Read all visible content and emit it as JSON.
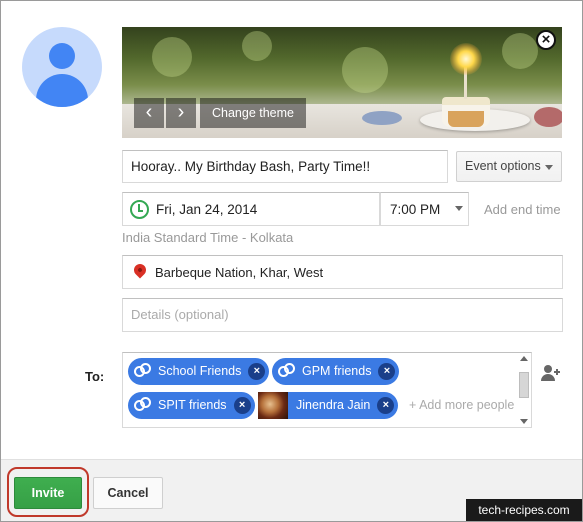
{
  "theme": {
    "prev_glyph": "‹",
    "next_glyph": "›",
    "change_theme_label": "Change theme",
    "close_glyph": "×"
  },
  "event": {
    "title": "Hooray.. My Birthday Bash, Party Time!!",
    "options_label": "Event options",
    "date": "Fri, Jan 24, 2014",
    "time": "7:00 PM",
    "add_end_time_label": "Add end time",
    "timezone": "India Standard Time - Kolkata",
    "location": "Barbeque Nation, Khar, West",
    "details_placeholder": "Details (optional)"
  },
  "guests": {
    "to_label": "To:",
    "chips": [
      {
        "label": "School Friends",
        "kind": "group"
      },
      {
        "label": "GPM friends",
        "kind": "group"
      },
      {
        "label": "SPIT friends",
        "kind": "group"
      },
      {
        "label": "Jinendra Jain",
        "kind": "person"
      }
    ],
    "remove_glyph": "×",
    "add_more_placeholder": "+ Add more people"
  },
  "footer": {
    "invite_label": "Invite",
    "cancel_label": "Cancel",
    "watermark": "tech-recipes.com"
  },
  "colors": {
    "chip_blue": "#3b7ae3",
    "invite_green": "#3fae4f",
    "highlight_red": "#c0392b",
    "clock_green": "#34a853",
    "pin_red": "#d93025"
  }
}
